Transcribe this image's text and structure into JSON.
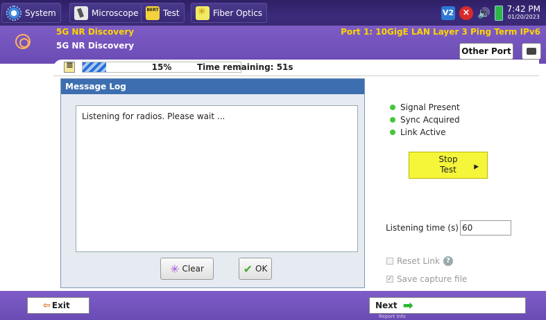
{
  "taskbar": {
    "tabs": [
      {
        "label": "System",
        "icon": "gear-icon"
      },
      {
        "label": "Microscope",
        "icon": "microscope-icon"
      },
      {
        "label": "Test",
        "icon": "bert-icon",
        "icon_text": "BERT"
      },
      {
        "label": "Fiber Optics",
        "icon": "fiber-icon"
      }
    ],
    "tray": {
      "v2_label": "V2",
      "time": "7:42 PM",
      "date": "01/20/2023"
    }
  },
  "header": {
    "title": "5G NR Discovery",
    "subtitle": "5G NR Discovery",
    "port_title": "Port 1: 10GigE LAN Layer 3 Ping Term IPv6",
    "other_port_label": "Other Port"
  },
  "progress": {
    "percent_label": "15%",
    "fraction": 0.15,
    "time_remaining": "Time remaining: 51s"
  },
  "message_log": {
    "title": "Message Log",
    "text": "Listening for radios. Please wait ...",
    "clear_label": "Clear",
    "ok_label": "OK"
  },
  "status": {
    "items": [
      "Signal Present",
      "Sync Acquired",
      "Link Active"
    ],
    "led_color": "#43c83a"
  },
  "stop_button": {
    "line1": "Stop",
    "line2": "Test"
  },
  "listening": {
    "label": "Listening time (s)",
    "value": "60"
  },
  "options": {
    "reset_link": "Reset Link",
    "save_capture": "Save capture file"
  },
  "footer": {
    "exit_label": "Exit",
    "next_label": "Next",
    "next_sub": "Report Info"
  },
  "colors": {
    "accent_purple": "#6a4bb4",
    "title_yellow": "#ffd400",
    "stop_yellow": "#f5f53a",
    "dialog_header": "#3d6fb0"
  }
}
